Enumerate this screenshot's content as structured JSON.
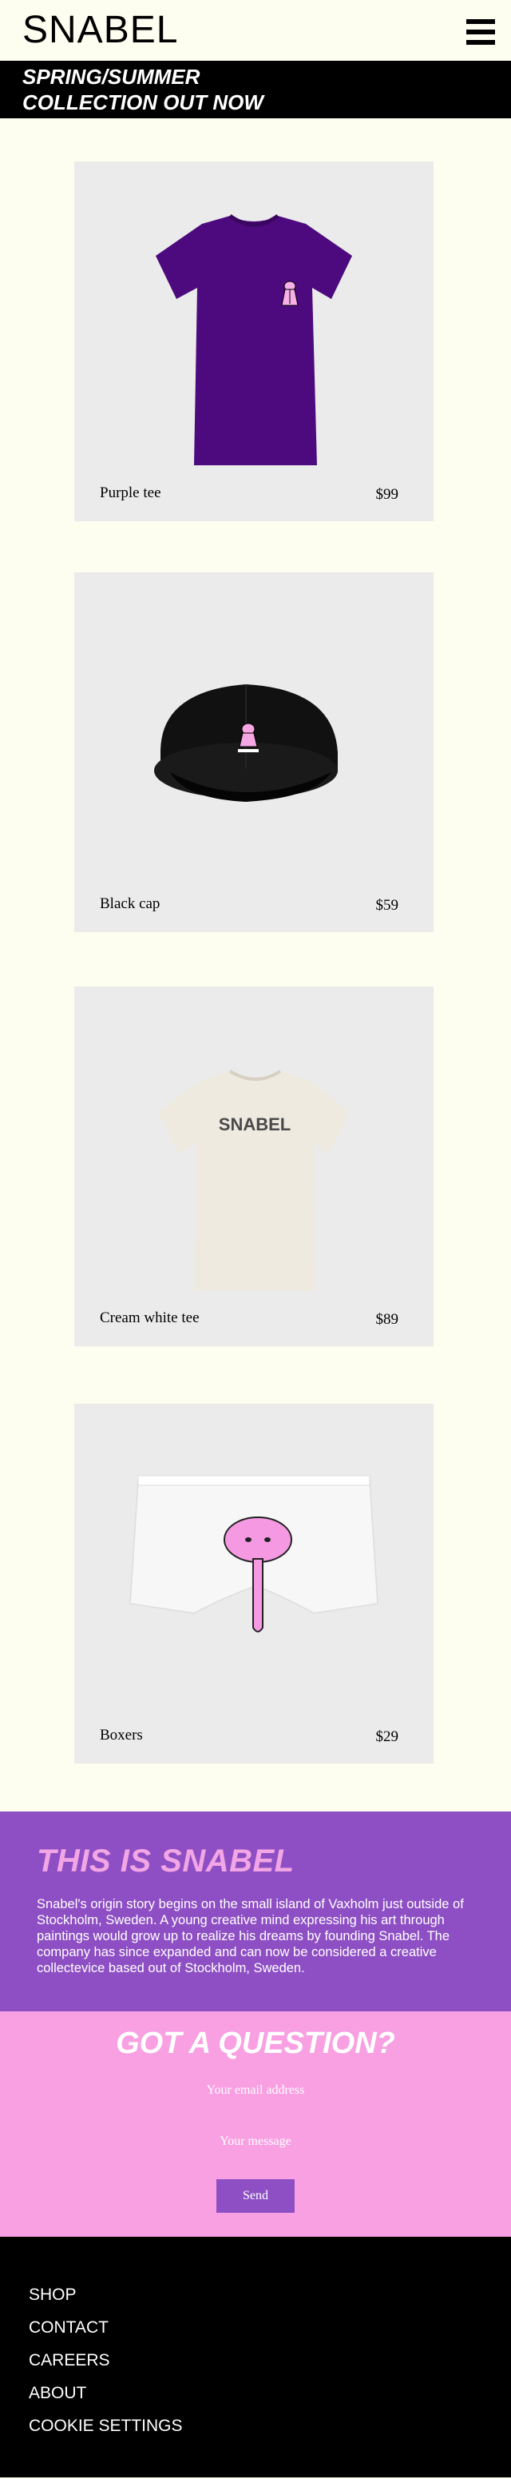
{
  "header": {
    "logo": "SNABEL",
    "menu_icon": "hamburger-menu-icon"
  },
  "banner": {
    "line1": "SPRING/SUMMER",
    "line2": "COLLECTION OUT NOW"
  },
  "products": [
    {
      "name": "Purple tee",
      "price": "$99",
      "image": "purple-tshirt-image",
      "color": "#4d0a7e"
    },
    {
      "name": "Black cap",
      "price": "$59",
      "image": "black-cap-image",
      "color": "#0f0f0f"
    },
    {
      "name": "Cream white tee",
      "price": "$89",
      "image": "cream-tshirt-image",
      "color": "#eeeae0",
      "print": "SNABEL"
    },
    {
      "name": "Boxers",
      "price": "$29",
      "image": "boxers-image",
      "color": "#f7f7f7"
    }
  ],
  "about": {
    "title": "THIS IS SNABEL",
    "text": "Snabel's origin story begins on the small island of Vaxholm just outside of Stockholm, Sweden. A young creative mind expressing his art through paintings would grow up to realize his dreams by founding Snabel. The company has since expanded and can now be considered a creative collectevice based out of Stockholm, Sweden."
  },
  "contact": {
    "title": "GOT A QUESTION?",
    "email_placeholder": "Your email address",
    "message_placeholder": "Your message",
    "send_label": "Send"
  },
  "footer": {
    "links": [
      "SHOP",
      "CONTACT",
      "CAREERS",
      "ABOUT",
      "COOKIE SETTINGS"
    ]
  },
  "colors": {
    "background": "#fdfdf0",
    "purple": "#8e4fc4",
    "pink": "#f8a0e2",
    "light_pink": "#f3a6e5",
    "black": "#000000"
  }
}
